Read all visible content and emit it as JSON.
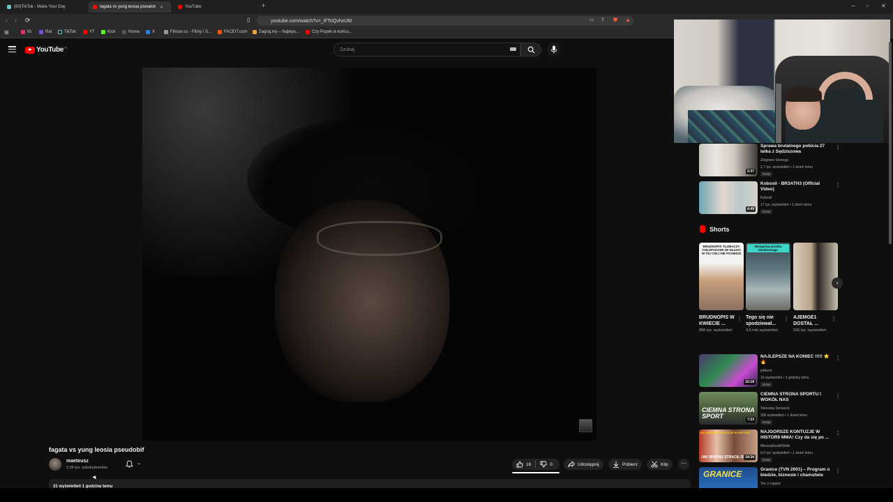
{
  "browser": {
    "tabs": [
      {
        "label": "(63)TikTok - Make Your Day",
        "color": "#69c9d0"
      },
      {
        "label": "fagata vs yung leosia pseudobif",
        "color": "#ff0000"
      },
      {
        "label": "YouTube",
        "color": "#ff0000"
      }
    ],
    "url": "youtube.com/watch?v=_iFToQvhxUM",
    "bookmarks": [
      {
        "label": "IG",
        "color": "#e1306c"
      },
      {
        "label": "Rat",
        "color": "#7b4cd8"
      },
      {
        "label": "TikTok",
        "color": "#111111"
      },
      {
        "label": "YT",
        "color": "#ff0000"
      },
      {
        "label": "Kick",
        "color": "#53fc18"
      },
      {
        "label": "Home",
        "color": "#444444"
      },
      {
        "label": "X",
        "color": "#2a7de1"
      },
      {
        "label": "Filman.cc - Filmy i S...",
        "color": "#999999"
      },
      {
        "label": "FACEIT.com",
        "color": "#ff5500"
      },
      {
        "label": "Zagraj.my – Najleps...",
        "color": "#e8a53a"
      },
      {
        "label": "Czy Popek w końcu...",
        "color": "#ff0000"
      }
    ]
  },
  "header": {
    "logo_word": "YouTube",
    "logo_country": "PL",
    "search_placeholder": "Szukaj"
  },
  "video": {
    "title": "fagata vs yung leosia pseudobif",
    "channel": "maeteusz",
    "subscribers": "3,35 tys. subskrybentów",
    "likes": "16",
    "dislikes": "0",
    "share_label": "Udostępnij",
    "download_label": "Pobierz",
    "clip_label": "Klip",
    "description_meta": "31 wyświetleń  1 godzinę temu"
  },
  "sidebar": {
    "top_recs": [
      {
        "title": "Sprawa brutalnego pobicia 27 latka z Sędziszowa",
        "channel": "Zbigniew Stonoga",
        "meta": "2,7 tys. wyświetleń • 1 dzień temu",
        "badge": "Nowy",
        "duration": "2:37"
      },
      {
        "title": "Kobosil - BR3ATH3 (Official Video)",
        "channel": "Kobosil",
        "meta": "17 tys. wyświetleń • 1 dzień temu",
        "badge": "Nowy",
        "duration": "4:49"
      }
    ],
    "shorts_heading": "Shorts",
    "shorts": [
      {
        "title": "BRUDNOPIS W KWIECIE ...",
        "views": "888 tys. wyświetleń",
        "caption": "BRUDNOPIS TŁUMACZY CHŁOPAKOWI ZE DŁUGO W TEJ CELI NIE POSIEDZI"
      },
      {
        "title": "Tego się nie spodziewał...",
        "views": "4,6 mln wyświetleń",
        "caption": "Nietypowa prośba bezdomnego"
      },
      {
        "title": "AJEMGE1 DOSTAŁ ...",
        "views": "536 tys. wyświetleń",
        "caption": ""
      }
    ],
    "bottom_recs": [
      {
        "title": "NAJLEPSZE NA KONIEC !!!!! ⭐ 🔥",
        "channel": "p4duch",
        "meta": "10 wyświetleń • 3 godziny temu",
        "badge": "Nowy",
        "duration": "10:18"
      },
      {
        "title": "CIEMNA STRONA SPORTU I WOKÓŁ NAS",
        "channel": "Telewizja Szczecin",
        "meta": "306 wyświetleń • 1 dzień temu",
        "badge": "Nowy",
        "duration": "7:23",
        "overlay": "CIEMNA STRONA SPORT"
      },
      {
        "title": "NAJGORSZE KONTUZJE W HISTORII MMA! Czy da się po ...",
        "channel": "MieszajSzulkiWalki",
        "meta": "8,9 tys. wyświetleń • 1 dzień temu",
        "badge": "Nowy",
        "duration": "14:34",
        "overlay": "JAK BISPING STRACIŁ OKO"
      },
      {
        "title": "Granice (TVN 2001) – Program o biedzie, biznesie i chamstwie",
        "channel": "Ten z rogami",
        "meta": "",
        "badge": "",
        "duration": "",
        "overlay": "GRANICE"
      }
    ]
  },
  "colors": {
    "accent": "#ff0000",
    "background": "#0f0f0f"
  }
}
